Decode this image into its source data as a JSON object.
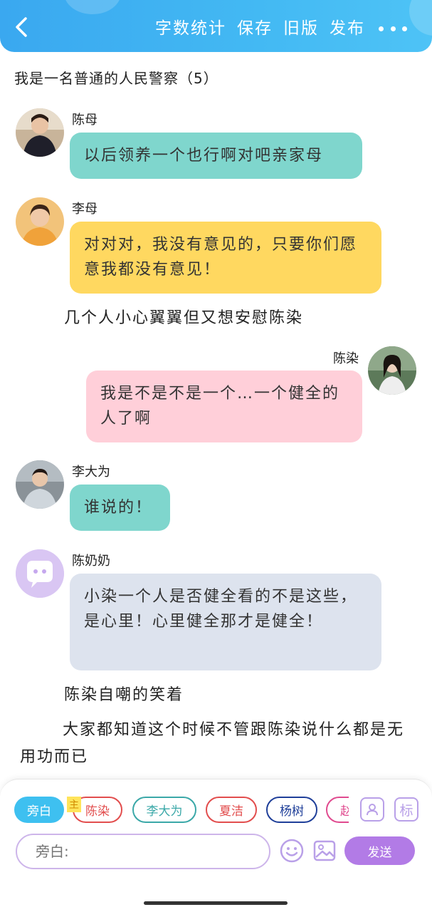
{
  "header": {
    "word_count_label": "字数统计",
    "save_label": "保存",
    "old_version_label": "旧版",
    "publish_label": "发布",
    "gradient": [
      "#3aa8f0",
      "#4ec3f6"
    ]
  },
  "doc": {
    "title": "我是一名普通的人民警察（5）"
  },
  "messages": [
    {
      "name": "陈母",
      "text": "以后领养一个也行啊对吧亲家母",
      "color": "#7fd6cd"
    },
    {
      "name": "李母",
      "text": "对对对，我没有意见的，只要你们愿意我都没有意见！",
      "color": "#ffd860"
    },
    {
      "name": "陈染",
      "text": "我是不是不是一个…一个健全的人了啊",
      "color": "#ffcfd9"
    },
    {
      "name": "李大为",
      "text": "谁说的！",
      "color": "#7fd6cd"
    },
    {
      "name": "陈奶奶",
      "text": "小染一个人是否健全看的不是这些，是心里！心里健全那才是健全！",
      "color": "#dde3ee"
    }
  ],
  "narrations": [
    "几个人小心翼翼但又想安慰陈染",
    "陈染自嘲的笑着",
    "大家都知道这个时候不管跟陈染说什么都是无用功而已"
  ],
  "composer": {
    "chips": [
      "旁白",
      "陈染",
      "李大为",
      "夏洁",
      "杨树",
      "赵"
    ],
    "main_badge": "主",
    "label_icon": "标",
    "placeholder": "旁白:",
    "send_label": "发送",
    "accent": "#b27be6"
  }
}
